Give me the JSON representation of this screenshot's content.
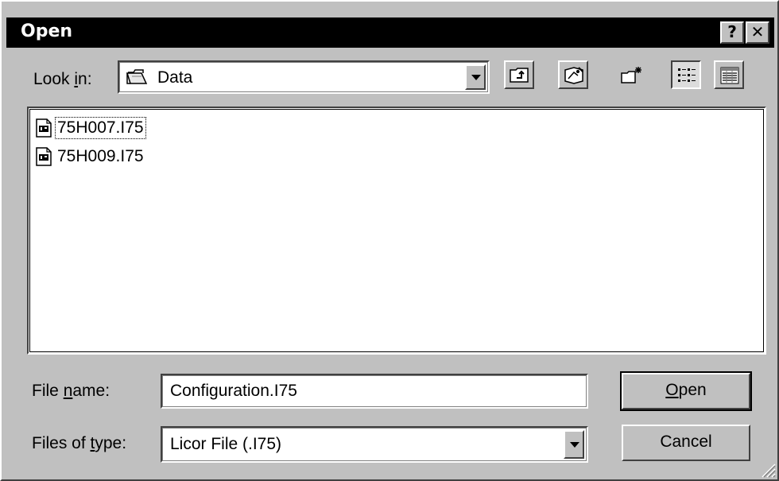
{
  "window": {
    "title": "Open",
    "help_label": "?",
    "close_label": "✕"
  },
  "look_in": {
    "label_prefix": "Look ",
    "label_accel": "i",
    "label_suffix": "n:",
    "value": "Data",
    "folder_icon": "open-folder-icon"
  },
  "toolbar": {
    "buttons": [
      "up-one-level-icon",
      "desktop-icon",
      "create-new-folder-icon",
      "list-view-icon",
      "details-view-icon"
    ],
    "active_view": "list"
  },
  "files": [
    {
      "name": "75H007.I75",
      "icon": "document-icon",
      "focused": true
    },
    {
      "name": "75H009.I75",
      "icon": "document-icon",
      "focused": false
    }
  ],
  "file_name": {
    "label_prefix": "File ",
    "label_accel": "n",
    "label_suffix": "ame:",
    "value": "Configuration.I75"
  },
  "files_of_type": {
    "label_prefix": "Files of ",
    "label_accel": "t",
    "label_suffix": "ype:",
    "value": "Licor File (.I75)"
  },
  "buttons": {
    "open_accel": "O",
    "open_rest": "pen",
    "cancel": "Cancel"
  },
  "colors": {
    "face": "#c0c0c0",
    "title_bar": "#000000",
    "title_text": "#ffffff"
  }
}
